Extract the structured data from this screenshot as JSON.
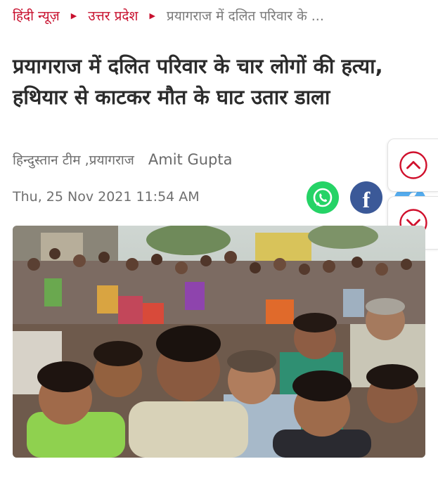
{
  "breadcrumb": {
    "home": "हिंदी न्यूज़",
    "section": "उत्तर प्रदेश",
    "current": "प्रयागराज में दलित परिवार के ..."
  },
  "article": {
    "headline": "प्रयागराज में दलित परिवार के चार लोगों की हत्या, हथियार से काटकर मौत के घाट उतार डाला",
    "source": "हिन्दुस्तान टीम ,प्रयागराज",
    "author": "Amit Gupta",
    "date": "Thu, 25 Nov 2021 11:54 AM"
  },
  "share": {
    "icons": [
      "whatsapp-icon",
      "facebook-icon",
      "twitter-icon"
    ]
  },
  "nav": {
    "icons": [
      "chevron-up-icon",
      "chevron-down-icon"
    ]
  },
  "colors": {
    "brand_red": "#c8102e",
    "headline": "#2b2b2b",
    "meta_gray": "#6f6f6f",
    "whatsapp": "#25d366",
    "facebook": "#3b5998",
    "twitter": "#55acee"
  }
}
